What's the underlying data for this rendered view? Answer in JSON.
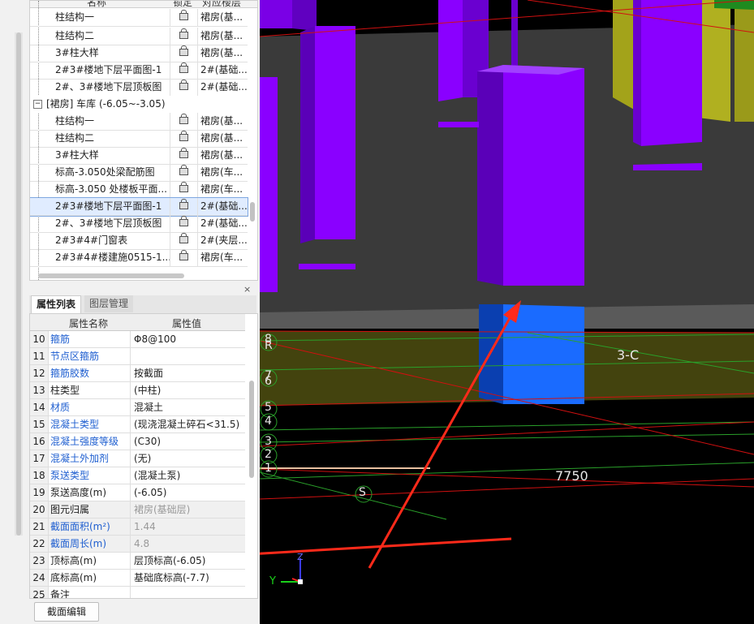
{
  "tree": {
    "headers": [
      "名称",
      "锁定",
      "对应楼层"
    ],
    "rows_top": [
      {
        "name": "柱结构一",
        "floor": "裙房(基..."
      },
      {
        "name": "柱结构二",
        "floor": "裙房(基..."
      },
      {
        "name": "3#柱大样",
        "floor": "裙房(基..."
      },
      {
        "name": "2#3#楼地下层平面图-1",
        "floor": "2#(基础..."
      },
      {
        "name": "2#、3#楼地下层顶板图",
        "floor": "2#(基础..."
      }
    ],
    "group": {
      "expander": "−",
      "label": "[裙房] 车库 (-6.05~-3.05)"
    },
    "rows_group": [
      {
        "name": "柱结构一",
        "floor": "裙房(基..."
      },
      {
        "name": "柱结构二",
        "floor": "裙房(基..."
      },
      {
        "name": "3#柱大样",
        "floor": "裙房(基..."
      },
      {
        "name": "标高-3.050处梁配筋图",
        "floor": "裙房(车..."
      },
      {
        "name": "标高-3.050 处楼板平面...",
        "floor": "裙房(车..."
      },
      {
        "name": "2#3#楼地下层平面图-1",
        "floor": "2#(基础...",
        "selected": true
      },
      {
        "name": "2#、3#楼地下层顶板图",
        "floor": "2#(基础..."
      },
      {
        "name": "2#3#4#门窗表",
        "floor": "2#(夹层..."
      },
      {
        "name": "2#3#4#楼建施0515-1...",
        "floor": "裙房(车..."
      }
    ]
  },
  "panel": {
    "close_icon": "×",
    "tabs": [
      "属性列表",
      "图层管理"
    ],
    "headers": [
      "属性名称",
      "属性值"
    ],
    "rows": [
      {
        "n": "10",
        "name": "箍筋",
        "value": "Φ8@100",
        "blue": true,
        "ro": false
      },
      {
        "n": "11",
        "name": "节点区箍筋",
        "value": "",
        "blue": true,
        "ro": false
      },
      {
        "n": "12",
        "name": "箍筋胶数",
        "value": "按截面",
        "blue": true,
        "ro": false
      },
      {
        "n": "13",
        "name": "柱类型",
        "value": "(中柱)",
        "blue": false,
        "ro": false
      },
      {
        "n": "14",
        "name": "材质",
        "value": "混凝土",
        "blue": true,
        "ro": false
      },
      {
        "n": "15",
        "name": "混凝土类型",
        "value": "(现浇混凝土碎石<31.5)",
        "blue": true,
        "ro": false
      },
      {
        "n": "16",
        "name": "混凝土强度等级",
        "value": "(C30)",
        "blue": true,
        "ro": false
      },
      {
        "n": "17",
        "name": "混凝土外加剂",
        "value": "(无)",
        "blue": true,
        "ro": false
      },
      {
        "n": "18",
        "name": "泵送类型",
        "value": "(混凝土泵)",
        "blue": true,
        "ro": false
      },
      {
        "n": "19",
        "name": "泵送高度(m)",
        "value": "(-6.05)",
        "blue": false,
        "ro": false
      },
      {
        "n": "20",
        "name": "图元归属",
        "value": "裙房(基础层)",
        "blue": false,
        "ro": true
      },
      {
        "n": "21",
        "name": "截面面积(m²)",
        "value": "1.44",
        "blue": true,
        "ro": true
      },
      {
        "n": "22",
        "name": "截面周长(m)",
        "value": "4.8",
        "blue": true,
        "ro": true
      },
      {
        "n": "23",
        "name": "顶标高(m)",
        "value": "层顶标高(-6.05)",
        "blue": false,
        "ro": false
      },
      {
        "n": "24",
        "name": "底标高(m)",
        "value": "基础底标高(-7.7)",
        "blue": false,
        "ro": false
      },
      {
        "n": "25",
        "name": "备注",
        "value": "",
        "blue": false,
        "ro": false
      }
    ],
    "button": "截面编辑"
  },
  "viewport": {
    "labels": {
      "grid_3c": "3-C",
      "dim_7750": "7750",
      "axis_s": "S",
      "axis_8": "8",
      "axis_r": "R",
      "axis_7": "7",
      "axis_6": "6",
      "axis_5": "5",
      "axis_4": "4",
      "axis_3": "3",
      "axis_2": "2",
      "axis_1": "1",
      "coord_y": "Y",
      "coord_z": "Z"
    }
  },
  "colors": {
    "column_purple": "#8a00ff",
    "column_blue": "#1a6bff",
    "slab_gray": "#3c3c3c",
    "olive": "#9a9a1a",
    "annotation_red": "#ff2a1a"
  }
}
